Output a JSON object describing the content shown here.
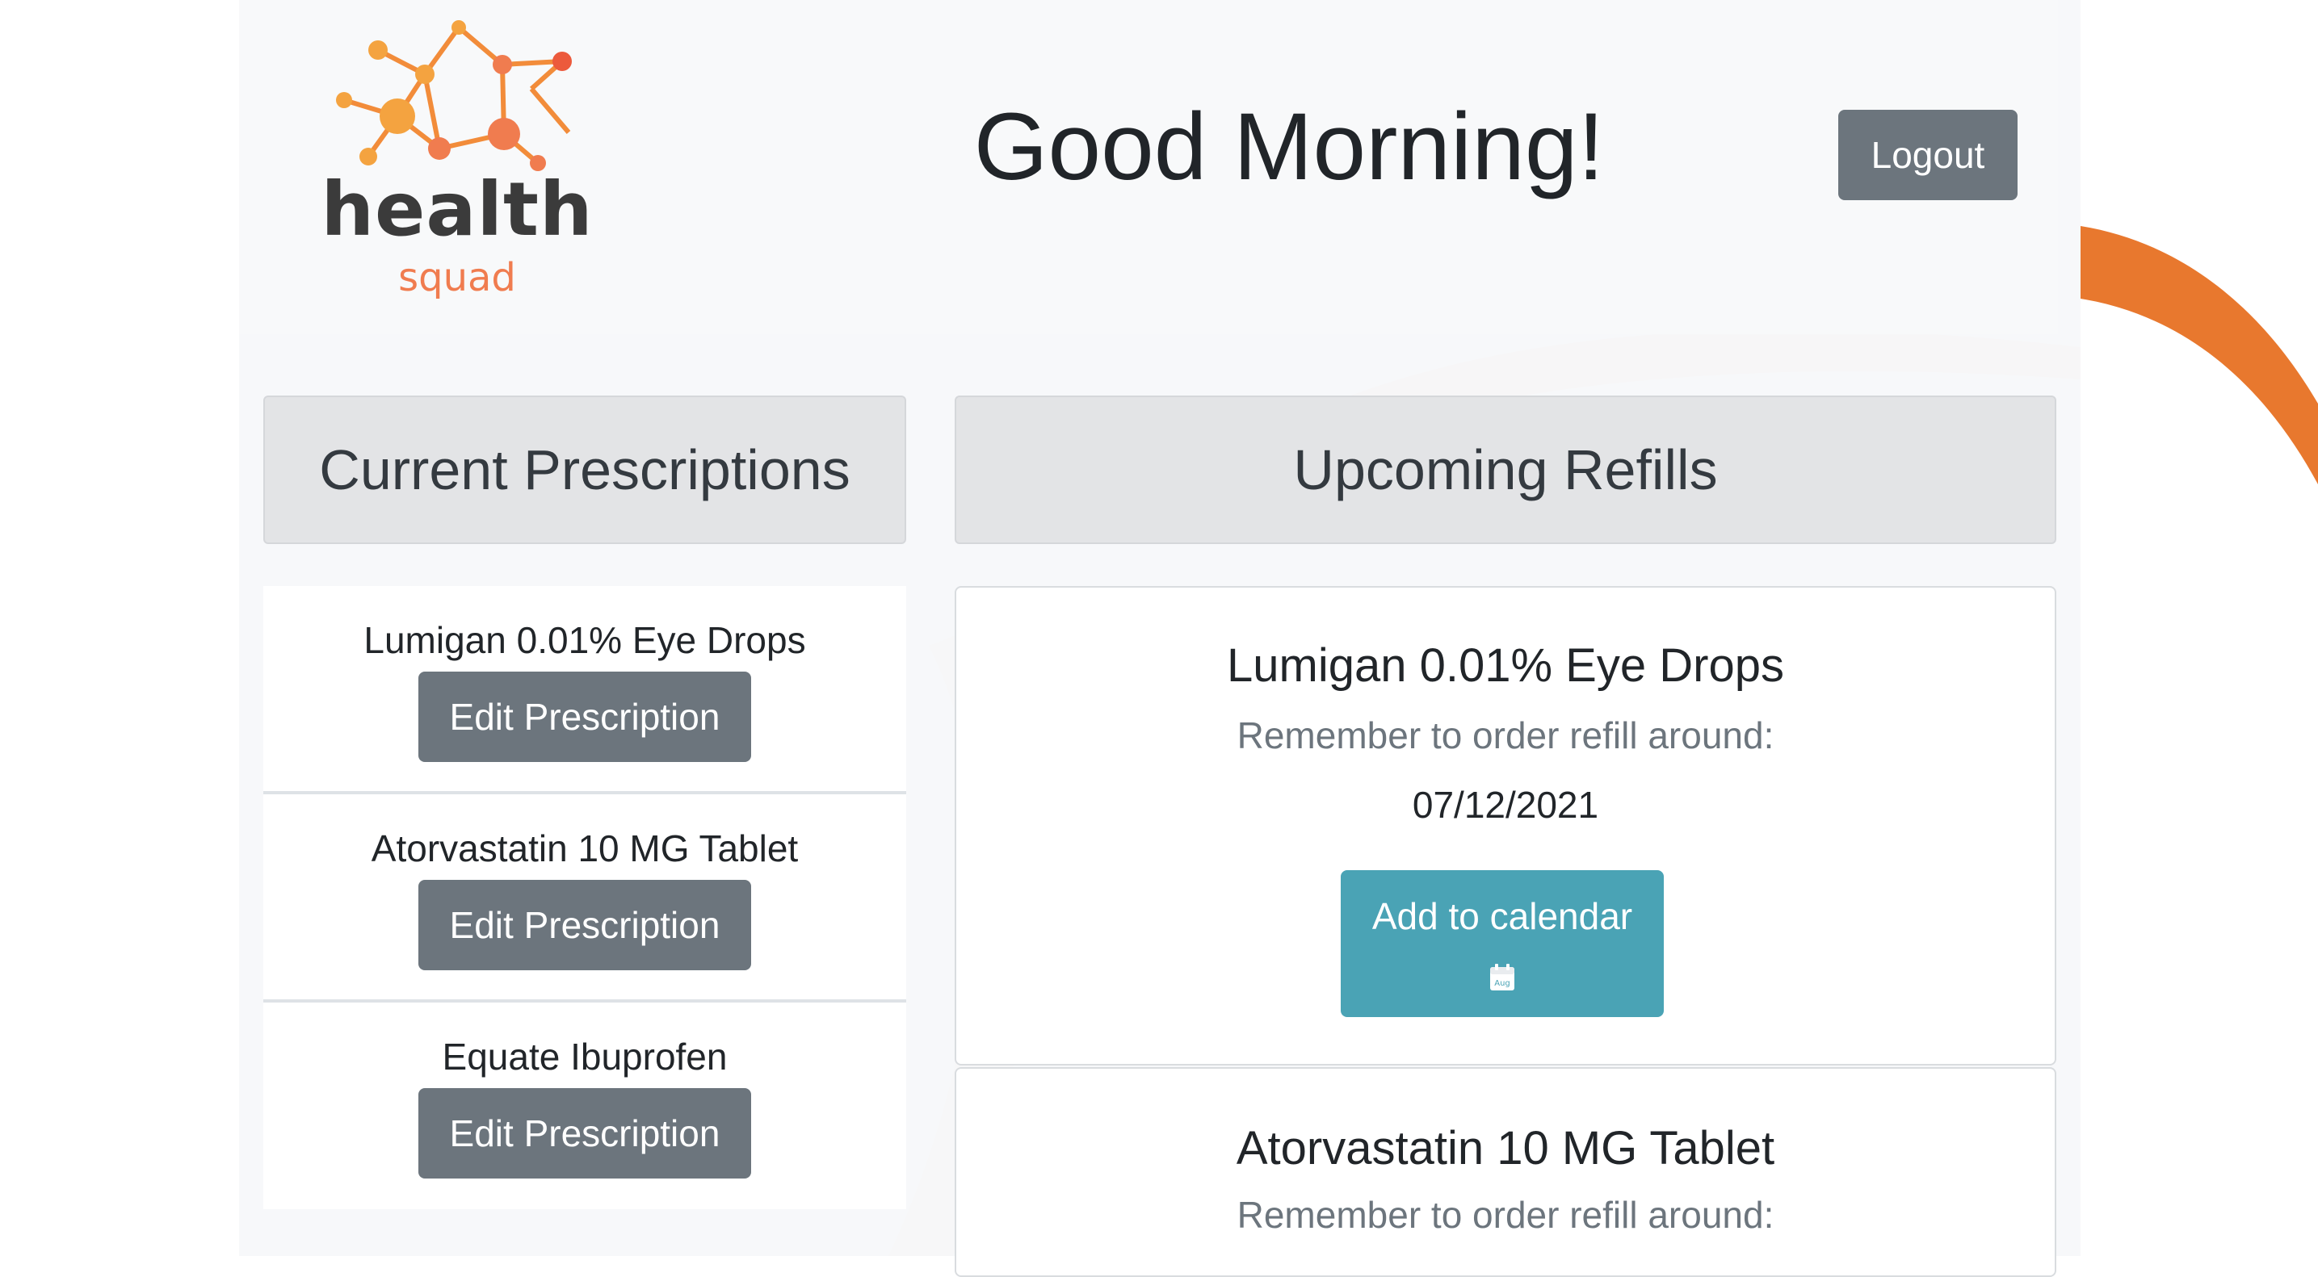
{
  "brand": {
    "name": "health",
    "subname": "squad",
    "accent_color": "#f07c4f"
  },
  "header": {
    "greeting": "Good Morning!",
    "logout_label": "Logout"
  },
  "prescriptions": {
    "title": "Current Prescriptions",
    "items": [
      {
        "name": "Lumigan 0.01% Eye Drops",
        "button": "Edit Prescription"
      },
      {
        "name": "Atorvastatin 10 MG Tablet",
        "button": "Edit Prescription"
      },
      {
        "name": "Equate Ibuprofen",
        "button": "Edit Prescription"
      }
    ]
  },
  "refills": {
    "title": "Upcoming Refills",
    "items": [
      {
        "name": "Lumigan 0.01% Eye Drops",
        "note": "Remember to order refill around:",
        "date": "07/12/2021",
        "button": "Add to calendar",
        "icon": "calendar-icon",
        "icon_text": "Aug"
      },
      {
        "name": "Atorvastatin 10 MG Tablet",
        "note": "Remember to order refill around:"
      }
    ]
  },
  "colors": {
    "secondary_button": "#6c757d",
    "calendar_button": "#4aa3b5"
  }
}
